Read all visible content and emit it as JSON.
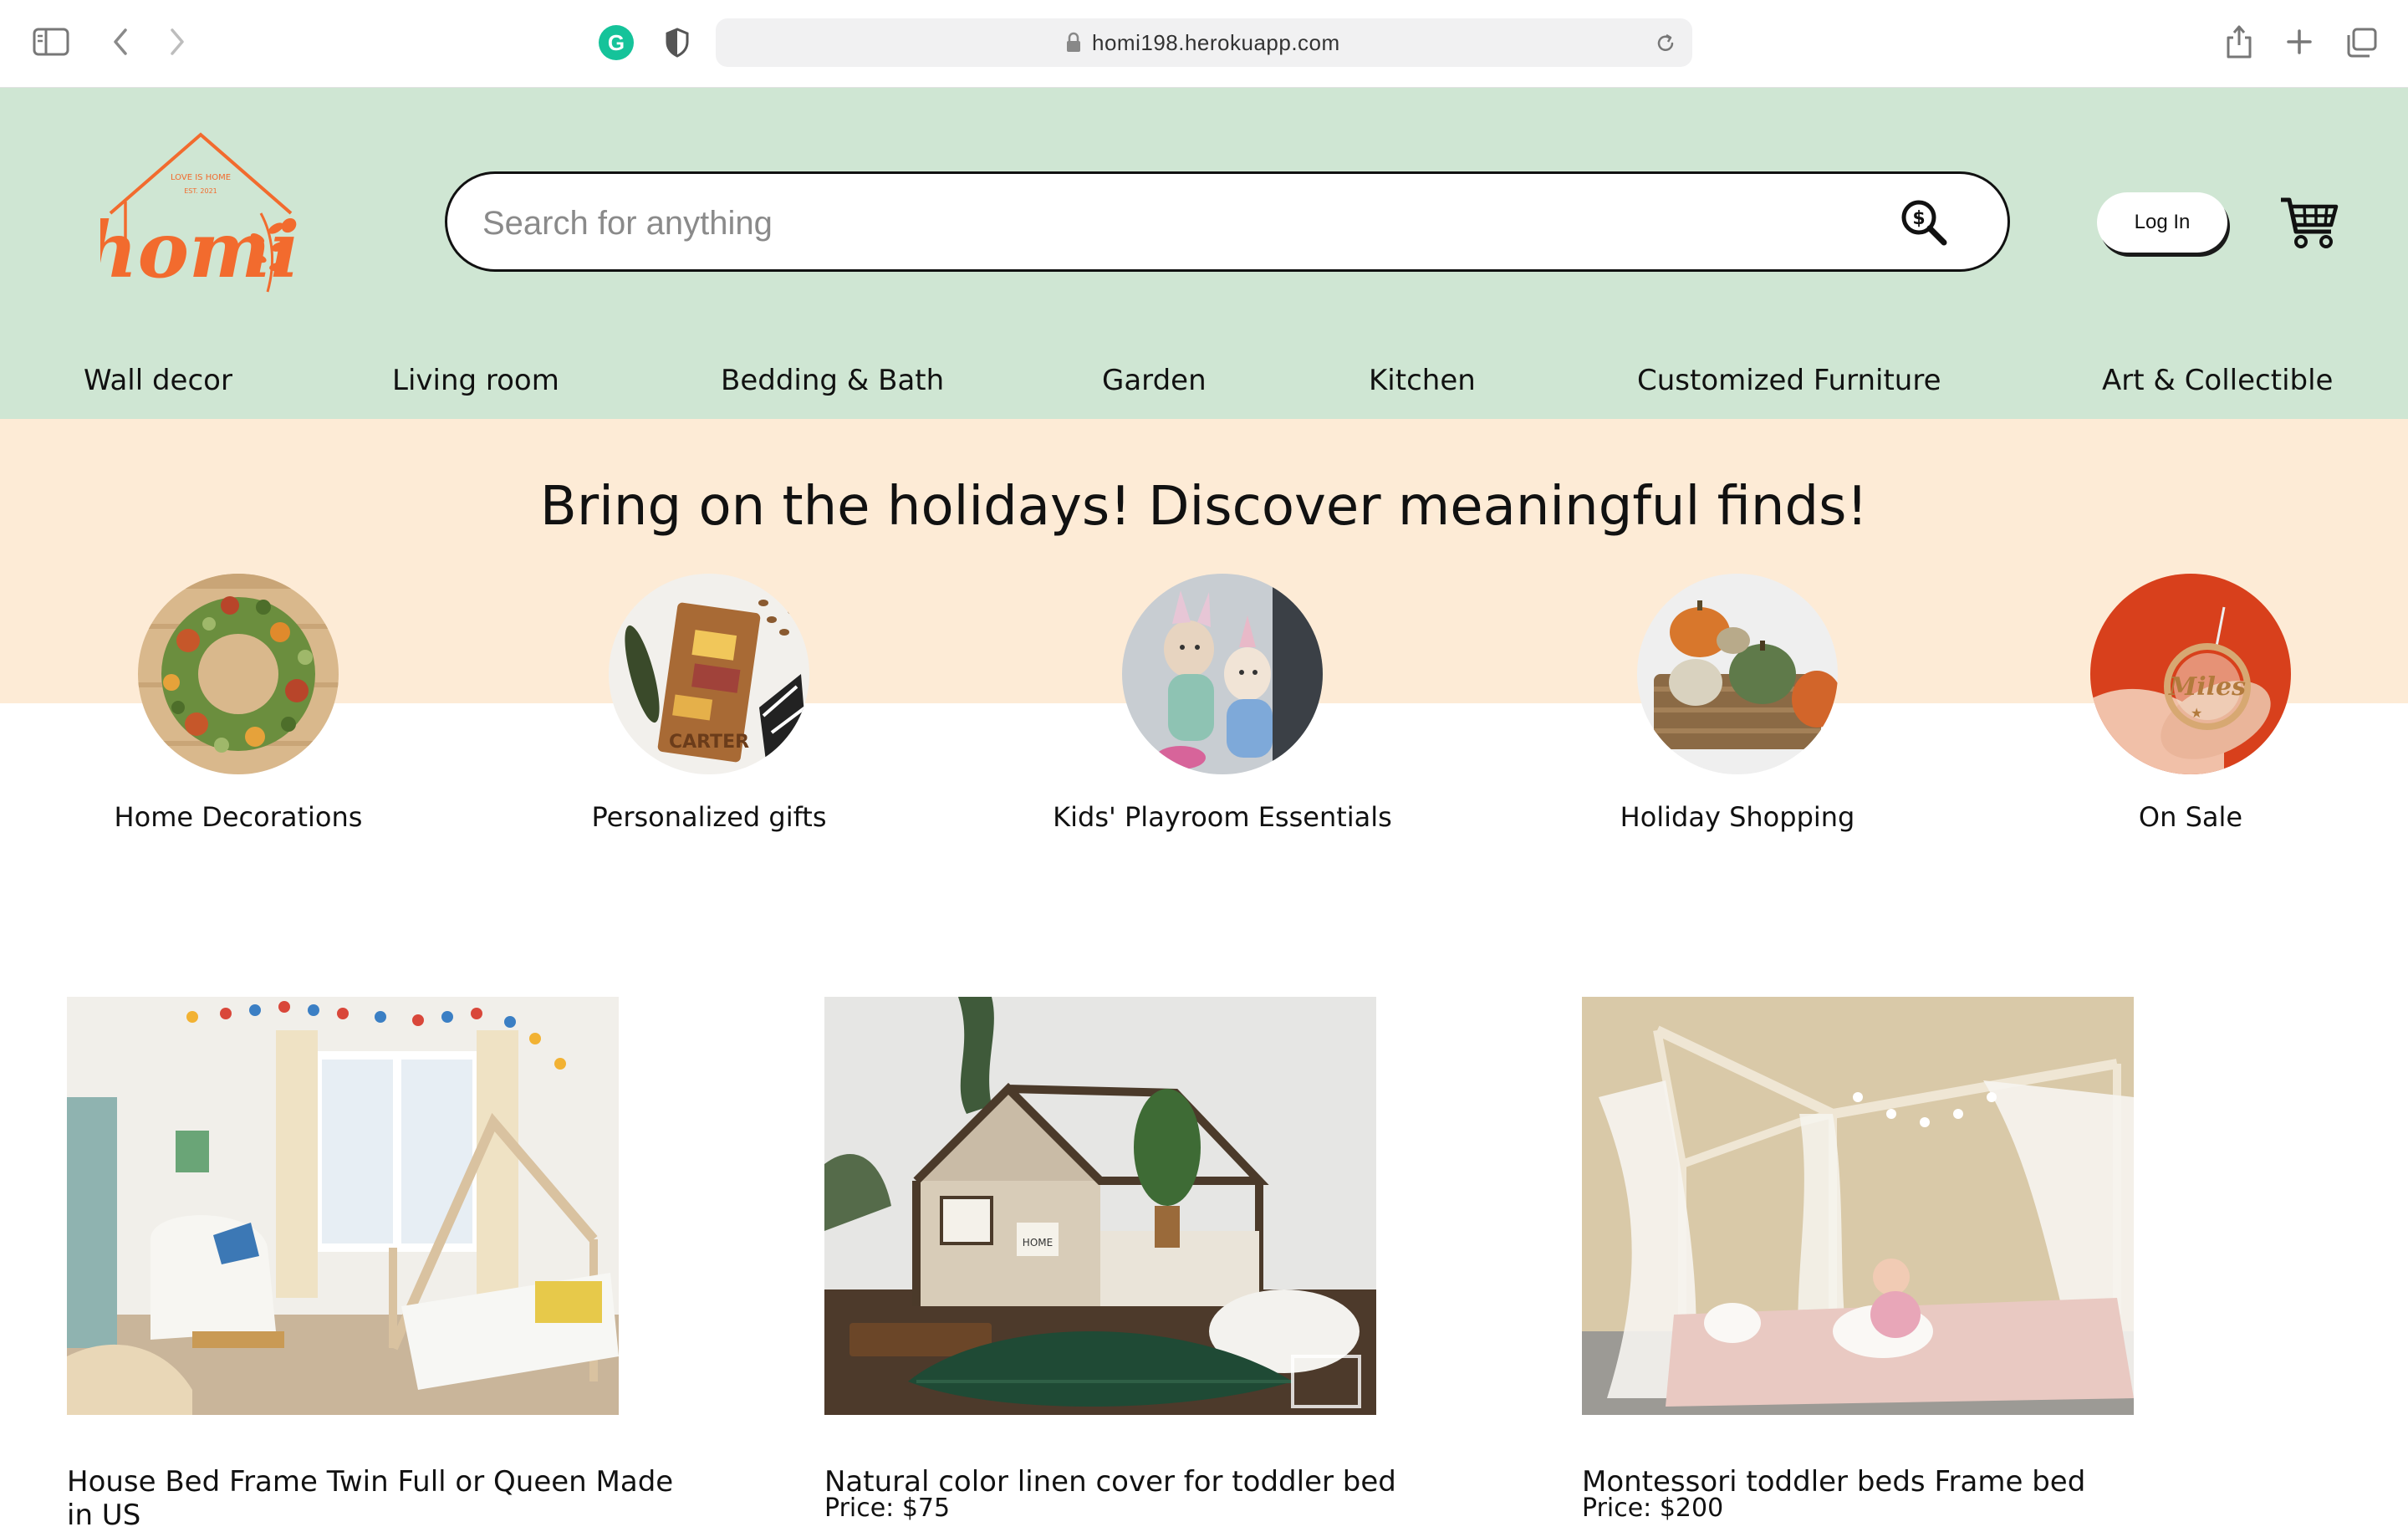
{
  "browser": {
    "url": "homi198.herokuapp.com",
    "grammarly_letter": "G"
  },
  "header": {
    "logo": {
      "brand": "homi",
      "arc_text": "LOVE IS HOME",
      "est_text": "EST. 2021",
      "color": "#f26b2e"
    },
    "search": {
      "placeholder": "Search for anything",
      "value": ""
    },
    "login_label": "Log In",
    "background": "#cfe6d3"
  },
  "nav": {
    "items": [
      {
        "label": "Wall decor"
      },
      {
        "label": "Living room"
      },
      {
        "label": "Bedding & Bath"
      },
      {
        "label": "Garden"
      },
      {
        "label": "Kitchen"
      },
      {
        "label": "Customized Furniture"
      },
      {
        "label": "Art & Collectible"
      }
    ]
  },
  "promo": {
    "title": "Bring on the holidays! Discover meaningful finds!",
    "background": "#fdebd6",
    "categories": [
      {
        "label": "Home Decorations"
      },
      {
        "label": "Personalized gifts",
        "board_text": "CARTER"
      },
      {
        "label": "Kids' Playroom Essentials"
      },
      {
        "label": "Holiday Shopping"
      },
      {
        "label": "On Sale",
        "ornament_text": "Miles"
      }
    ]
  },
  "products": [
    {
      "title": "House Bed Frame Twin Full or Queen Made in US",
      "price": ""
    },
    {
      "title": "Natural color linen cover for toddler bed",
      "price": "Price: $75",
      "sign_text": "HOME"
    },
    {
      "title": "Montessori toddler beds Frame bed",
      "price": "Price: $200"
    }
  ]
}
